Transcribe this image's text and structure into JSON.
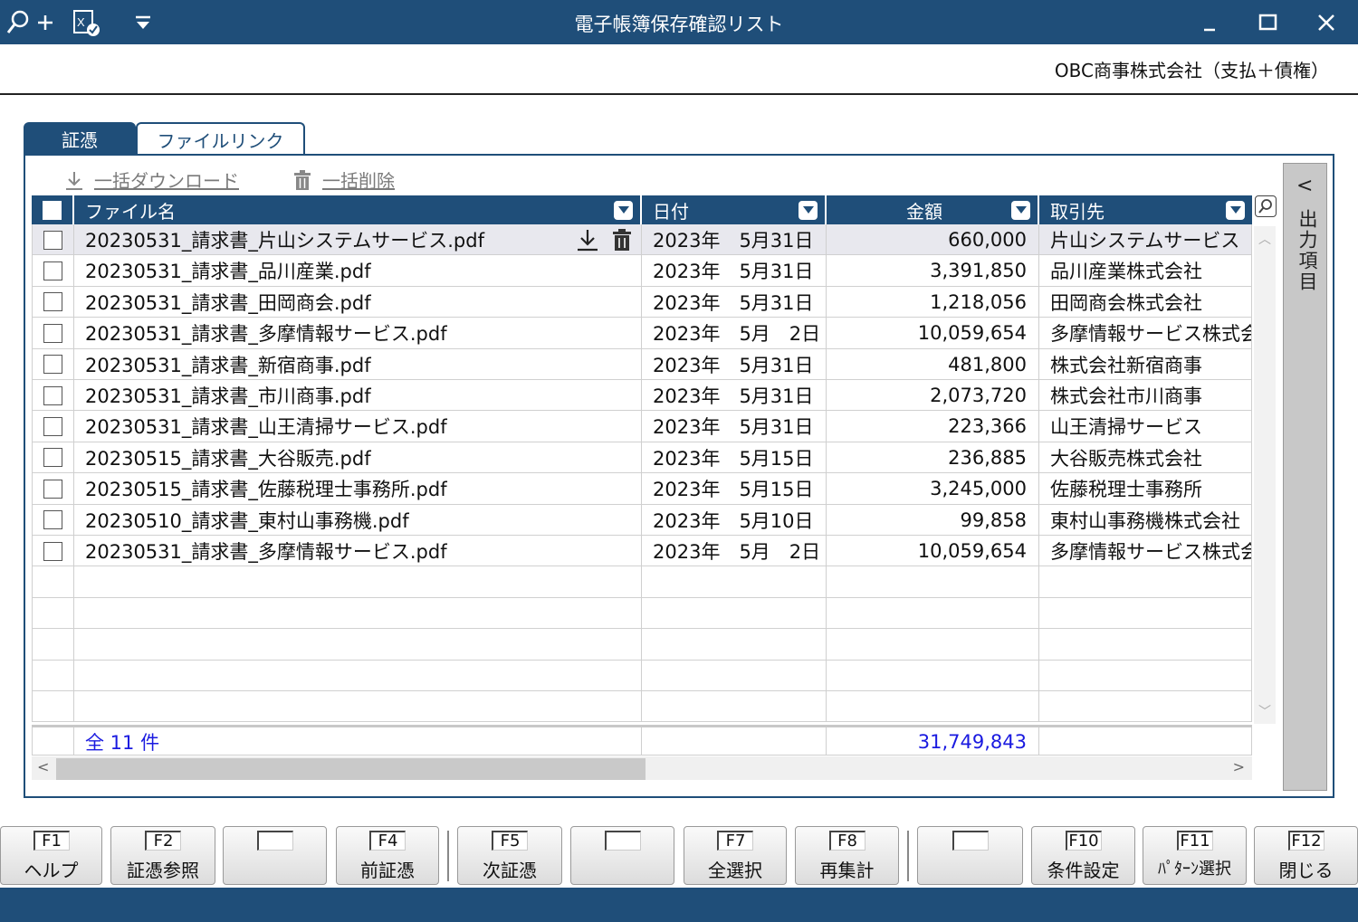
{
  "window": {
    "title": "電子帳簿保存確認リスト"
  },
  "company": "OBC商事株式会社（支払＋債権）",
  "tabs": [
    {
      "label": "証憑"
    },
    {
      "label": "ファイルリンク"
    }
  ],
  "toolbar": {
    "bulk_download": "一括ダウンロード",
    "bulk_delete": "一括削除"
  },
  "columns": {
    "filename": "ファイル名",
    "date": "日付",
    "amount": "金額",
    "supplier": "取引先"
  },
  "rows": [
    {
      "file": "20230531_請求書_片山システムサービス.pdf",
      "date": "2023年　5月31日",
      "amount": "660,000",
      "supplier": "片山システムサービス"
    },
    {
      "file": "20230531_請求書_品川産業.pdf",
      "date": "2023年　5月31日",
      "amount": "3,391,850",
      "supplier": "品川産業株式会社"
    },
    {
      "file": "20230531_請求書_田岡商会.pdf",
      "date": "2023年　5月31日",
      "amount": "1,218,056",
      "supplier": "田岡商会株式会社"
    },
    {
      "file": "20230531_請求書_多摩情報サービス.pdf",
      "date": "2023年　5月　2日",
      "amount": "10,059,654",
      "supplier": "多摩情報サービス株式会社"
    },
    {
      "file": "20230531_請求書_新宿商事.pdf",
      "date": "2023年　5月31日",
      "amount": "481,800",
      "supplier": "株式会社新宿商事"
    },
    {
      "file": "20230531_請求書_市川商事.pdf",
      "date": "2023年　5月31日",
      "amount": "2,073,720",
      "supplier": "株式会社市川商事"
    },
    {
      "file": "20230531_請求書_山王清掃サービス.pdf",
      "date": "2023年　5月31日",
      "amount": "223,366",
      "supplier": "山王清掃サービス"
    },
    {
      "file": "20230515_請求書_大谷販売.pdf",
      "date": "2023年　5月15日",
      "amount": "236,885",
      "supplier": "大谷販売株式会社"
    },
    {
      "file": "20230515_請求書_佐藤税理士事務所.pdf",
      "date": "2023年　5月15日",
      "amount": "3,245,000",
      "supplier": "佐藤税理士事務所"
    },
    {
      "file": "20230510_請求書_東村山事務機.pdf",
      "date": "2023年　5月10日",
      "amount": "99,858",
      "supplier": "東村山事務機株式会社"
    },
    {
      "file": "20230531_請求書_多摩情報サービス.pdf",
      "date": "2023年　5月　2日",
      "amount": "10,059,654",
      "supplier": "多摩情報サービス株式会社"
    }
  ],
  "totals": {
    "count_label": "全 11 件",
    "amount": "31,749,843"
  },
  "side_panel": {
    "label": "出力項目"
  },
  "function_keys": [
    {
      "key": "F1",
      "label": "ヘルプ"
    },
    {
      "key": "F2",
      "label": "証憑参照"
    },
    {
      "key": "",
      "label": ""
    },
    {
      "key": "F4",
      "label": "前証憑"
    },
    {
      "key": "F5",
      "label": "次証憑"
    },
    {
      "key": "",
      "label": ""
    },
    {
      "key": "F7",
      "label": "全選択"
    },
    {
      "key": "F8",
      "label": "再集計"
    },
    {
      "key": "",
      "label": ""
    },
    {
      "key": "F10",
      "label": "条件設定"
    },
    {
      "key": "F11",
      "label": "ﾊﾟﾀｰﾝ選択"
    },
    {
      "key": "F12",
      "label": "閉じる"
    }
  ]
}
